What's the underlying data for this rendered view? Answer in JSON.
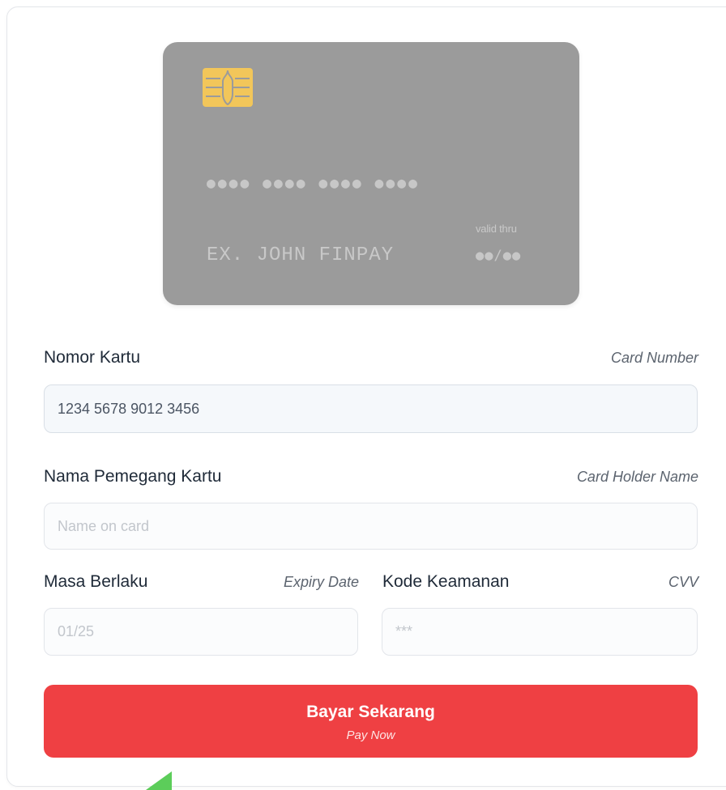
{
  "card_preview": {
    "number": "●●●● ●●●● ●●●● ●●●●",
    "holder": "EX. JOHN FINPAY",
    "valid_thru_label": "valid thru",
    "expiry": "●●/●●",
    "chip_icon": "chip-icon",
    "card_color": "#9b9b9b",
    "chip_color": "#f2c65a"
  },
  "form": {
    "card_number": {
      "label": "Nomor Kartu",
      "hint": "Card Number",
      "value": "1234 5678 9012 3456"
    },
    "holder_name": {
      "label": "Nama Pemegang Kartu",
      "hint": "Card Holder Name",
      "value": "",
      "placeholder": "Name on card"
    },
    "expiry": {
      "label": "Masa Berlaku",
      "hint": "Expiry Date",
      "value": "",
      "placeholder": "01/25"
    },
    "cvv": {
      "label": "Kode Keamanan",
      "hint": "CVV",
      "value": "",
      "placeholder": "***"
    }
  },
  "pay_button": {
    "label": "Bayar Sekarang",
    "sublabel": "Pay Now",
    "color": "#ef4043"
  },
  "colors": {
    "label_text": "#1f2a38",
    "hint_text": "#5b636e",
    "accent_green": "#5ccd5a"
  }
}
